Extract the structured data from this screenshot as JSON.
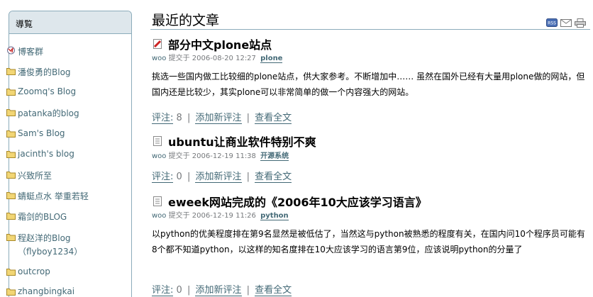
{
  "sidebar": {
    "title": "導覧",
    "items": [
      {
        "label": "博客群",
        "icon": "globe-icon"
      },
      {
        "label": "潘俊勇的Blog",
        "icon": "folder-icon"
      },
      {
        "label": "Zoomq's Blog",
        "icon": "folder-icon"
      },
      {
        "label": "patanka的blog",
        "icon": "folder-icon"
      },
      {
        "label": "Sam's Blog",
        "icon": "folder-icon"
      },
      {
        "label": "jacinth's blog",
        "icon": "folder-icon"
      },
      {
        "label": "兴致所至",
        "icon": "folder-icon"
      },
      {
        "label": "蜻蜓点水 举重若轻",
        "icon": "folder-icon"
      },
      {
        "label": "霜剑的BLOG",
        "icon": "folder-icon"
      },
      {
        "label": "程赵洋的Blog",
        "sub": "（flyboy1234）",
        "icon": "folder-icon"
      },
      {
        "label": "outcrop",
        "icon": "folder-icon"
      },
      {
        "label": "zhangbingkai",
        "icon": "folder-icon"
      }
    ]
  },
  "main": {
    "title": "最近的文章",
    "doc_actions": [
      {
        "name": "rss-icon",
        "label": "RSS"
      },
      {
        "name": "email-icon",
        "label": ""
      },
      {
        "name": "print-icon",
        "label": ""
      }
    ],
    "entries": [
      {
        "title": "部分中文plone站点",
        "author": "woo",
        "submitted": "提交于",
        "date": "2006-08-20 12:27",
        "tag": "plone",
        "description": "挑选一些国内做工比较细的plone站点，供大家参考。不断增加中…… 虽然在国外已经有大量用plone做的网站，但国内还是比较少，其实plone可以非常简单的做一个内容强大的网站。",
        "comments_label": "评注:",
        "comments_count": "8",
        "add_comment": "添加新评注",
        "view_full": "查看全文"
      },
      {
        "title": "ubuntu让商业软件特别不爽",
        "author": "woo",
        "submitted": "提交于",
        "date": "2006-12-19 11:38",
        "tag": "开源系统",
        "description": "",
        "comments_label": "评注:",
        "comments_count": "0",
        "add_comment": "添加新评注",
        "view_full": "查看全文"
      },
      {
        "title": "eweek网站完成的《2006年10大应该学习语言》",
        "author": "woo",
        "submitted": "提交于",
        "date": "2006-12-19 11:26",
        "tag": "python",
        "description": "以python的优美程度排在第9名显然是被低估了，当然这与python被熟悉的程度有关，在国内问10个程序员可能有8个都不知道python，以这样的知名度排在10大应该学习的语言第9位，应该说明python的分量了",
        "comments_label": "评注:",
        "comments_count": "0",
        "add_comment": "添加新评注",
        "view_full": "查看全文"
      }
    ]
  }
}
